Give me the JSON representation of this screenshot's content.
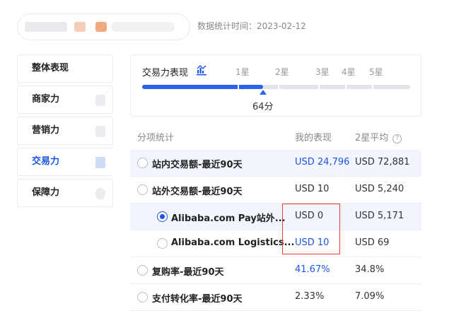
{
  "header": {
    "stat_time": "数据统计时间：2023-02-12"
  },
  "sidebar": {
    "items": [
      {
        "label": "整体表现",
        "active": false
      },
      {
        "label": "商家力",
        "active": false
      },
      {
        "label": "营销力",
        "active": false
      },
      {
        "label": "交易力",
        "active": true
      },
      {
        "label": "保障力",
        "active": false
      }
    ]
  },
  "score": {
    "title": "交易力表现",
    "levels": [
      "1星",
      "2星",
      "3星",
      "4星",
      "5星"
    ],
    "value_label": "64分",
    "progress_percent": 45
  },
  "table": {
    "headers": {
      "item": "分项统计",
      "mine": "我的表现",
      "avg": "2星平均",
      "help_icon": "question-circle-icon"
    },
    "rows": [
      {
        "label": "站内交易额-最近90天",
        "mine": "USD 24,796",
        "avg": "USD 72,881",
        "selected": false,
        "highlight": true,
        "indent": false,
        "mine_blue": true
      },
      {
        "label": "站外交易额-最近90天",
        "mine": "USD 10",
        "avg": "USD 5,240",
        "selected": false,
        "highlight": false,
        "indent": false,
        "mine_blue": false
      },
      {
        "label": "Alibaba.com Pay站外...",
        "mine": "USD 0",
        "avg": "USD 5,171",
        "selected": true,
        "highlight": true,
        "indent": true,
        "mine_blue": false
      },
      {
        "label": "Alibaba.com Logistics...",
        "mine": "USD 10",
        "avg": "USD 69",
        "selected": false,
        "highlight": false,
        "indent": true,
        "mine_blue": true
      },
      {
        "label": "复购率-最近90天",
        "mine": "41.67%",
        "avg": "34.8%",
        "selected": false,
        "highlight": false,
        "indent": false,
        "mine_blue": true
      },
      {
        "label": "支付转化率-最近90天",
        "mine": "2.33%",
        "avg": "7.09%",
        "selected": false,
        "highlight": false,
        "indent": false,
        "mine_blue": false
      }
    ]
  },
  "colors": {
    "accent": "#1a55e6",
    "highlight_box": "#e53935"
  }
}
